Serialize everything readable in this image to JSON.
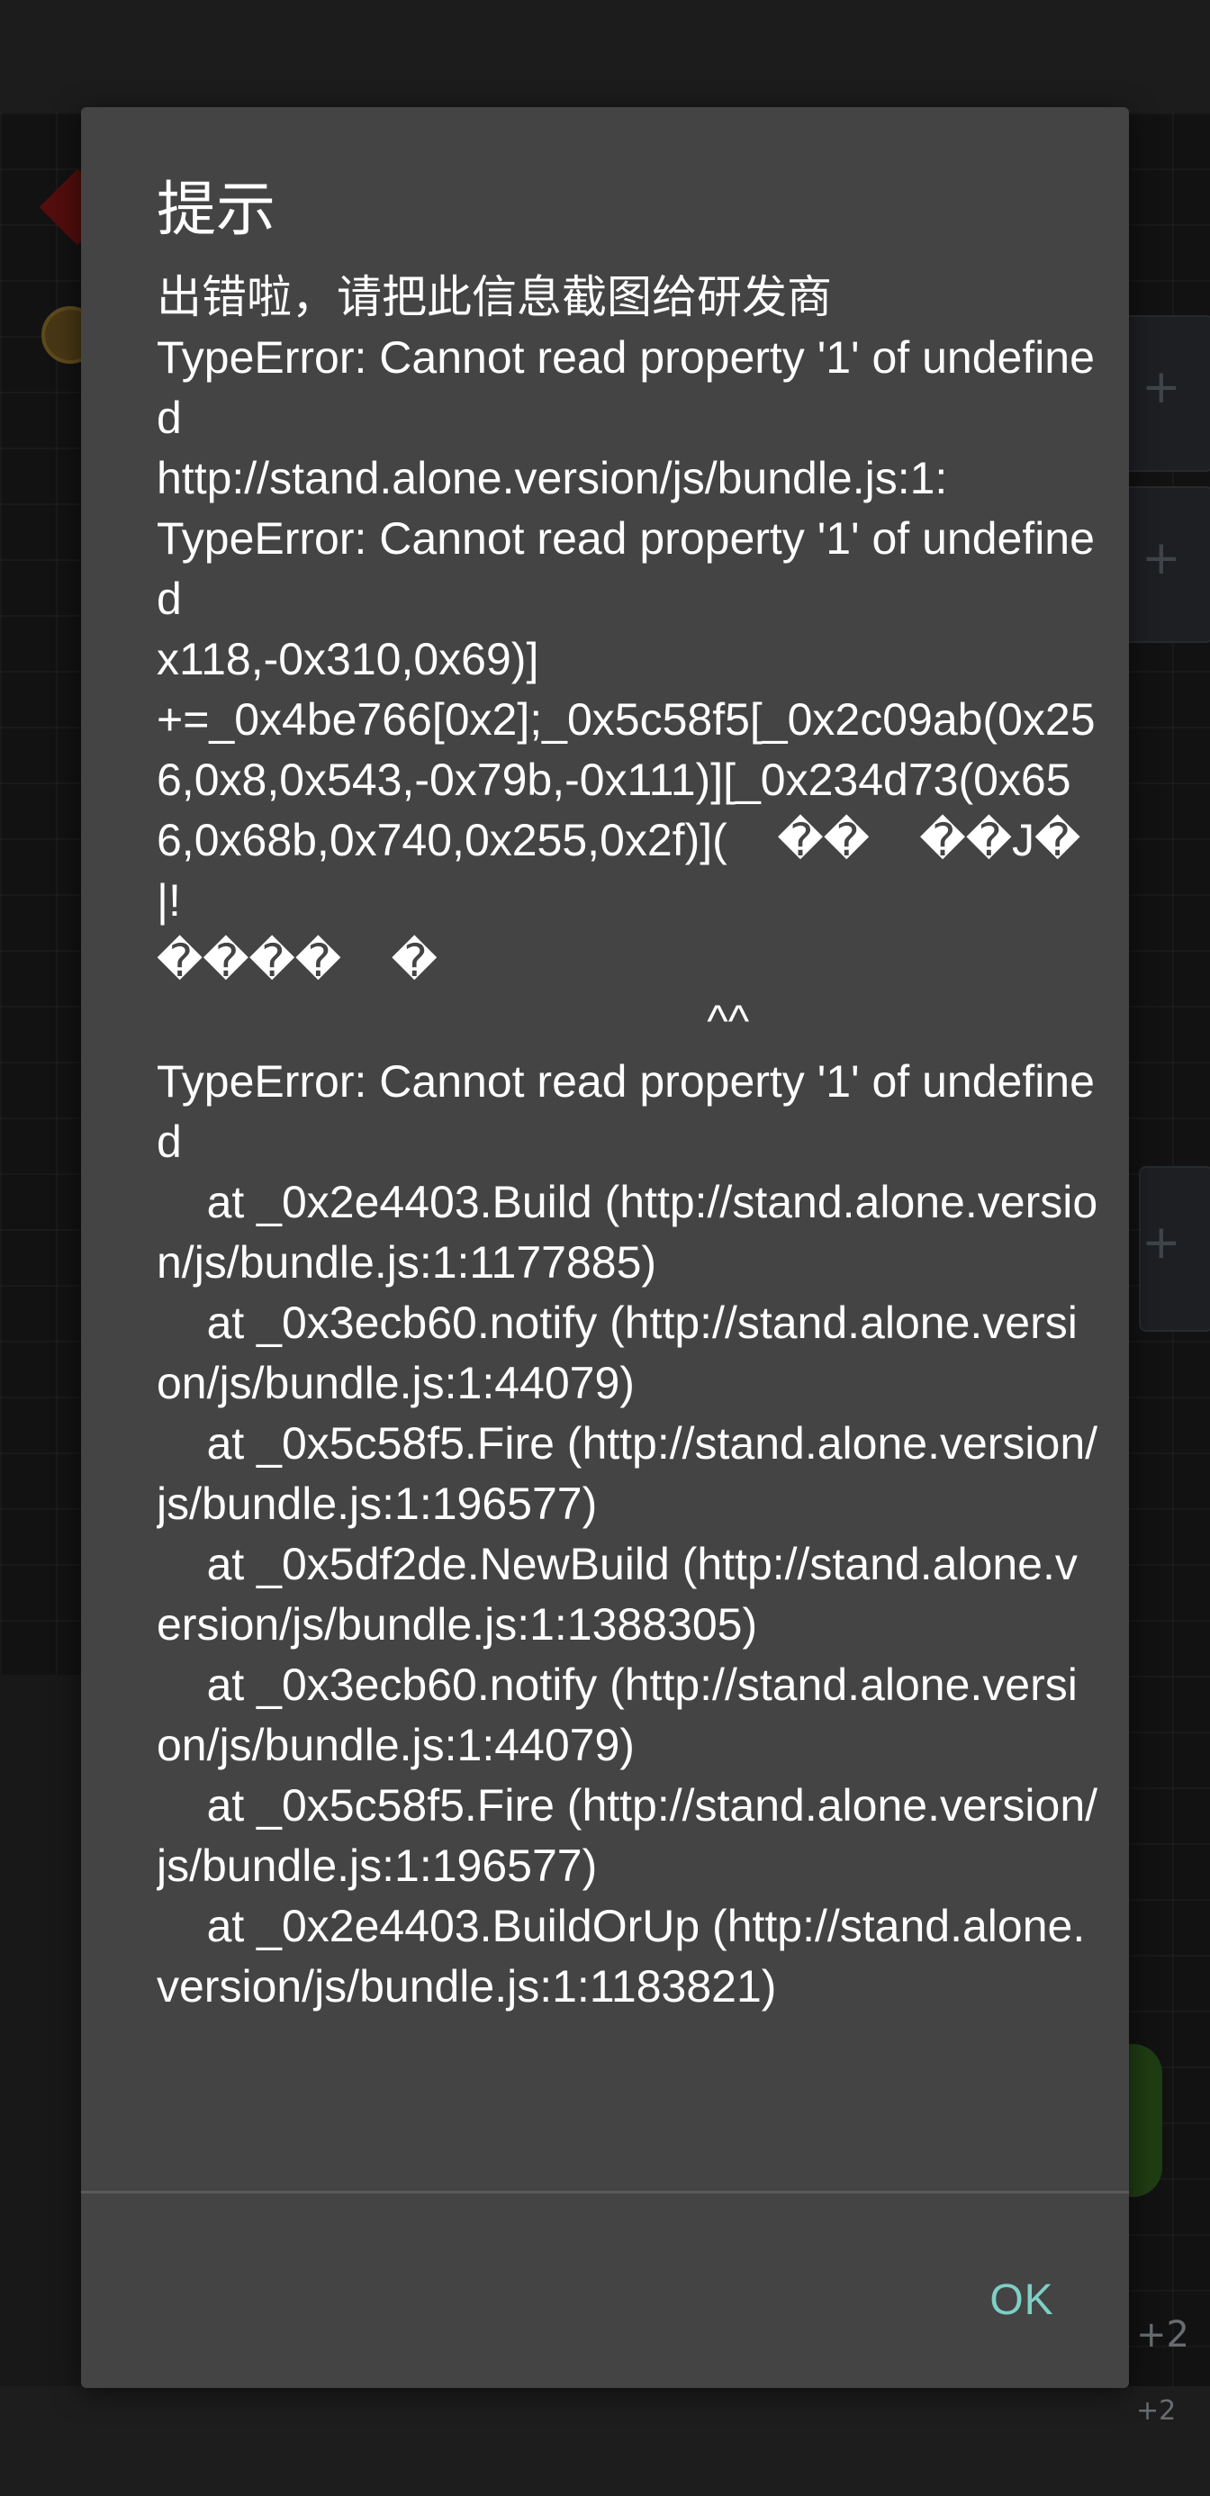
{
  "dialog": {
    "title": "提示",
    "message": "出错啦，请把此信息截图给研发商\nTypeError: Cannot read property '1' of undefined\nhttp://stand.alone.version/js/bundle.js:1:\nTypeError: Cannot read property '1' of undefined\nx118,-0x310,0x69)]\n+=_0x4be766[0x2];_0x5c58f5[_0x2c09ab(0x256,0x8,0x543,-0x79b,-0x111)][_0x234d73(0x656,0x68b,0x740,0x255,0x2f)](    ��    ��J�|!\n����    �\n                                            ^^\nTypeError: Cannot read property '1' of undefined\n    at _0x2e4403.Build (http://stand.alone.version/js/bundle.js:1:1177885)\n    at _0x3ecb60.notify (http://stand.alone.version/js/bundle.js:1:44079)\n    at _0x5c58f5.Fire (http://stand.alone.version/js/bundle.js:1:196577)\n    at _0x5df2de.NewBuild (http://stand.alone.version/js/bundle.js:1:1388305)\n    at _0x3ecb60.notify (http://stand.alone.version/js/bundle.js:1:44079)\n    at _0x5c58f5.Fire (http://stand.alone.version/js/bundle.js:1:196577)\n    at _0x2e4403.BuildOrUp (http://stand.alone.version/js/bundle.js:1:1183821)",
    "ok_label": "OK"
  },
  "background": {
    "badge_top": "+2",
    "badge_bottom": "+2"
  },
  "colors": {
    "dialog_bg": "#444444",
    "accent_ok": "#7fcfc6",
    "text": "#ffffff"
  }
}
